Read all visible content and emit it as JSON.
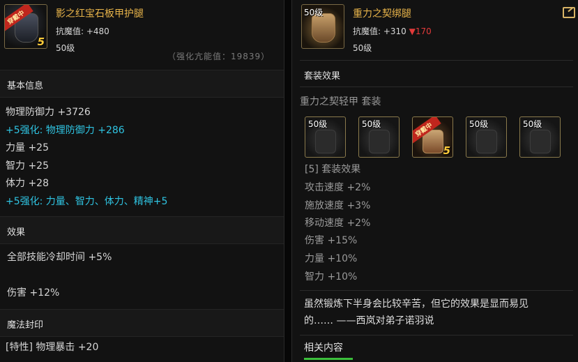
{
  "left": {
    "item_name": "影之红宝石板甲护腿",
    "resist_label": "抗魔值: ",
    "resist_value": "+480",
    "level": "50级",
    "badge": "穿戴中",
    "badge_num": "5",
    "cut_text": "（强化亢能值：19839）",
    "basic_title": "基本信息",
    "basic_lines": [
      "物理防御力 +3726",
      "+5强化: 物理防御力 +286",
      "力量 +25",
      "智力 +25",
      "体力 +28",
      "+5强化: 力量、智力、体力、精神+5"
    ],
    "effect_title": "效果",
    "effect_lines": [
      "全部技能冷却时间 +5%",
      "伤害 +12%"
    ],
    "seal_title": "魔法封印",
    "seal_line": "[特性] 物理暴击 +20"
  },
  "right": {
    "item_name": "重力之契绑腿",
    "resist_label": "抗魔值: ",
    "resist_value": "+310",
    "resist_down": "▼170",
    "level": "50级",
    "icon_level": "50级",
    "set_title": "套装效果",
    "set_name": "重力之契轻甲 套装",
    "slots": [
      {
        "level": "50级",
        "active": false
      },
      {
        "level": "50级",
        "active": false
      },
      {
        "level": "",
        "active": true,
        "badge": "穿戴中",
        "num": "5"
      },
      {
        "level": "50级",
        "active": false
      },
      {
        "level": "50级",
        "active": false
      }
    ],
    "set_effect_title": "[5] 套装效果",
    "set_lines": [
      "攻击速度 +2%",
      "施放速度 +3%",
      "移动速度 +2%",
      "伤害 +15%",
      "力量 +10%",
      "智力 +10%"
    ],
    "desc_lines": [
      "虽然锻炼下半身会比较辛苦，但它的效果是显而易见",
      "的…… ——西岚对弟子诺羽说"
    ],
    "related_title": "相关内容"
  }
}
